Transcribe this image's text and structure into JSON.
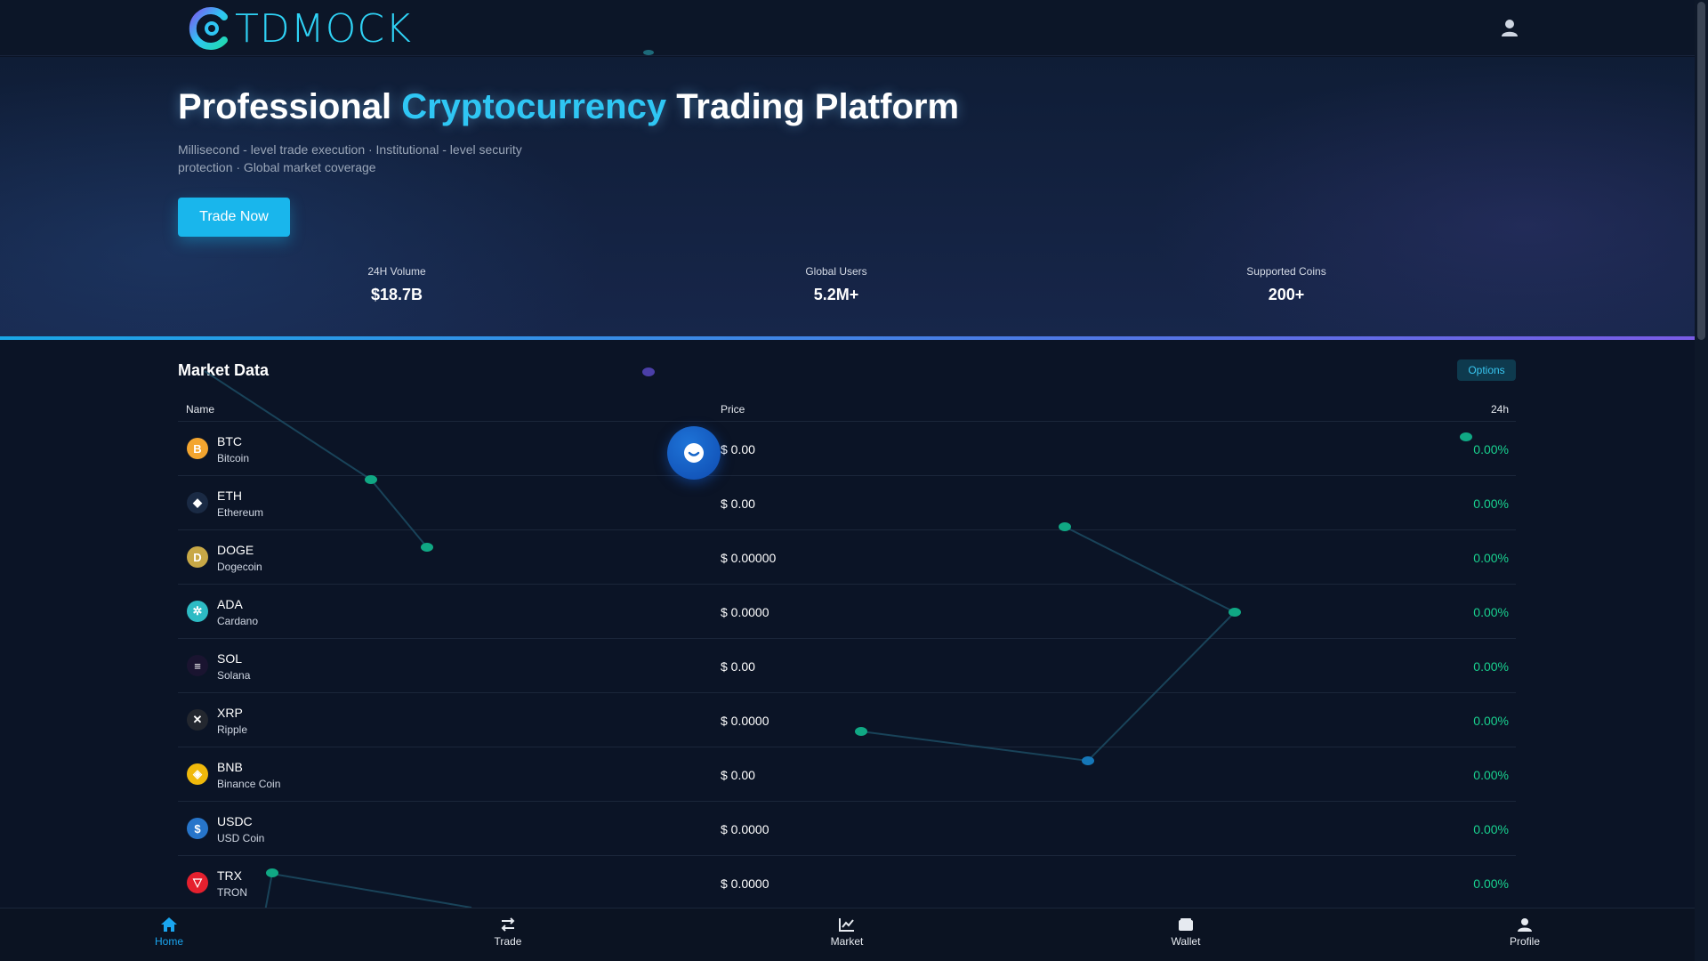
{
  "header": {
    "logo_text": "TDMOCK",
    "user_icon": "user-icon"
  },
  "hero": {
    "title_part1": "Professional ",
    "title_accent": "Cryptocurrency",
    "title_part2": " Trading Platform",
    "subtitle": "Millisecond - level trade execution · Institutional - level security protection · Global market coverage",
    "cta_label": "Trade Now",
    "stats": [
      {
        "label": "24H Volume",
        "value": "$18.7B"
      },
      {
        "label": "Global Users",
        "value": "5.2M+"
      },
      {
        "label": "Supported Coins",
        "value": "200+"
      }
    ]
  },
  "market": {
    "title": "Market Data",
    "options_label": "Options",
    "columns": {
      "name": "Name",
      "price": "Price",
      "change": "24h"
    },
    "rows": [
      {
        "symbol": "BTC",
        "name": "Bitcoin",
        "price": "$ 0.00",
        "change": "0.00%",
        "icon": "btc-icon",
        "icon_color": "#f3a52f",
        "glyph": "B"
      },
      {
        "symbol": "ETH",
        "name": "Ethereum",
        "price": "$ 0.00",
        "change": "0.00%",
        "icon": "eth-icon",
        "icon_color": "#1a2a44",
        "glyph": "◆"
      },
      {
        "symbol": "DOGE",
        "name": "Dogecoin",
        "price": "$ 0.00000",
        "change": "0.00%",
        "icon": "doge-icon",
        "icon_color": "#c8a846",
        "glyph": "D"
      },
      {
        "symbol": "ADA",
        "name": "Cardano",
        "price": "$ 0.0000",
        "change": "0.00%",
        "icon": "ada-icon",
        "icon_color": "#2dbbc4",
        "glyph": "✲"
      },
      {
        "symbol": "SOL",
        "name": "Solana",
        "price": "$ 0.00",
        "change": "0.00%",
        "icon": "sol-icon",
        "icon_color": "#1a1430",
        "glyph": "≡"
      },
      {
        "symbol": "XRP",
        "name": "Ripple",
        "price": "$ 0.0000",
        "change": "0.00%",
        "icon": "xrp-icon",
        "icon_color": "#23272f",
        "glyph": "✕"
      },
      {
        "symbol": "BNB",
        "name": "Binance Coin",
        "price": "$ 0.00",
        "change": "0.00%",
        "icon": "bnb-icon",
        "icon_color": "#f0b90b",
        "glyph": "◈"
      },
      {
        "symbol": "USDC",
        "name": "USD Coin",
        "price": "$ 0.0000",
        "change": "0.00%",
        "icon": "usdc-icon",
        "icon_color": "#2775ca",
        "glyph": "$"
      },
      {
        "symbol": "TRX",
        "name": "TRON",
        "price": "$ 0.0000",
        "change": "0.00%",
        "icon": "trx-icon",
        "icon_color": "#e5202e",
        "glyph": "▽"
      }
    ]
  },
  "chat_icon": "chat-support-icon",
  "bottom_nav": [
    {
      "label": "Home",
      "icon": "home-icon",
      "active": true
    },
    {
      "label": "Trade",
      "icon": "trade-icon",
      "active": false
    },
    {
      "label": "Market",
      "icon": "market-chart-icon",
      "active": false
    },
    {
      "label": "Wallet",
      "icon": "wallet-icon",
      "active": false
    },
    {
      "label": "Profile",
      "icon": "profile-icon",
      "active": false
    }
  ],
  "colors": {
    "accent": "#2fc6f4",
    "cta": "#19b6ec",
    "positive": "#19d18f",
    "background": "#0b1426"
  }
}
